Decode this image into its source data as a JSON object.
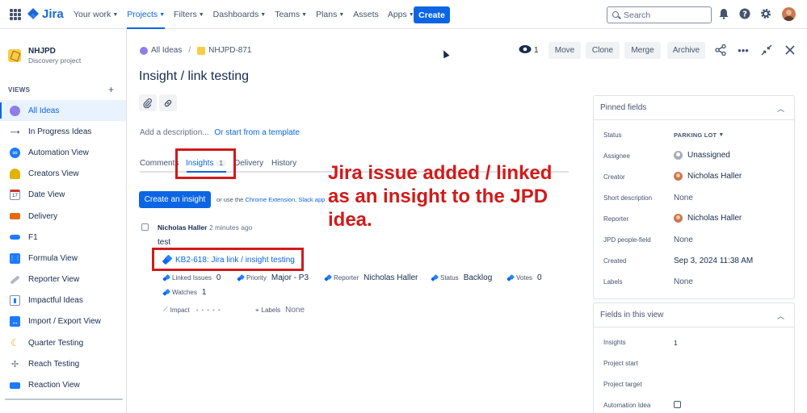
{
  "topnav": {
    "logo": "Jira",
    "items": [
      {
        "label": "Your work",
        "chevron": true,
        "active": false
      },
      {
        "label": "Projects",
        "chevron": true,
        "active": true
      },
      {
        "label": "Filters",
        "chevron": true,
        "active": false
      },
      {
        "label": "Dashboards",
        "chevron": true,
        "active": false
      },
      {
        "label": "Teams",
        "chevron": true,
        "active": false
      },
      {
        "label": "Plans",
        "chevron": true,
        "active": false
      },
      {
        "label": "Assets",
        "chevron": false,
        "active": false
      },
      {
        "label": "Apps",
        "chevron": true,
        "active": false
      }
    ],
    "create_label": "Create",
    "search_placeholder": "Search"
  },
  "sidebar": {
    "project_name": "NHJPD",
    "project_type": "Discovery project",
    "views_label": "VIEWS",
    "items": [
      {
        "label": "All Ideas",
        "icon": "globe-icon",
        "active": true,
        "color": "#8f7ee7"
      },
      {
        "label": "In Progress Ideas",
        "icon": "soon-arrow-icon",
        "active": false,
        "color": "#44546f"
      },
      {
        "label": "Automation View",
        "icon": "infinity-icon",
        "active": false,
        "color": "#1d7afc"
      },
      {
        "label": "Creators View",
        "icon": "construction-worker-icon",
        "active": false,
        "color": "#e2b203"
      },
      {
        "label": "Date View",
        "icon": "calendar-icon",
        "active": false,
        "color": "#c9372c"
      },
      {
        "label": "Delivery",
        "icon": "truck-icon",
        "active": false,
        "color": "#e56910"
      },
      {
        "label": "F1",
        "icon": "race-car-icon",
        "active": false,
        "color": "#1d7afc"
      },
      {
        "label": "Formula View",
        "icon": "abacus-icon",
        "active": false,
        "color": "#1d7afc"
      },
      {
        "label": "Reporter View",
        "icon": "syringe-icon",
        "active": false,
        "color": "#8590a2"
      },
      {
        "label": "Impactful Ideas",
        "icon": "bar-chart-icon",
        "active": false,
        "color": "#1d7afc"
      },
      {
        "label": "Import / Export View",
        "icon": "left-right-arrow-icon",
        "active": false,
        "color": "#1d7afc"
      },
      {
        "label": "Quarter Testing",
        "icon": "crescent-moon-icon",
        "active": false,
        "color": "#e2b203"
      },
      {
        "label": "Reach Testing",
        "icon": "satellite-icon",
        "active": false,
        "color": "#626f86"
      },
      {
        "label": "Reaction View",
        "icon": "cable-car-icon",
        "active": false,
        "color": "#1d7afc"
      }
    ]
  },
  "breadcrumb": {
    "root": "All Ideas",
    "key": "NHJPD-871"
  },
  "header": {
    "watch_count": "1",
    "buttons": [
      "Move",
      "Clone",
      "Merge",
      "Archive"
    ]
  },
  "idea": {
    "title": "Insight / link testing",
    "desc_placeholder": "Add a description...",
    "desc_template_link": "Or start from a template"
  },
  "tabs": {
    "comments": "Comments",
    "insights": "Insights",
    "insights_count": "1",
    "delivery": "Delivery",
    "history": "History"
  },
  "insights": {
    "create_button": "Create an insight",
    "ext_prefix": "or use the",
    "ext_link1": "Chrome Extension",
    "ext_sep": ",",
    "ext_link2": "Slack app",
    "author": "Nicholas Haller",
    "time": "2 minutes ago",
    "text": "test",
    "linked_issue": "KB2-618: Jira link / insight testing",
    "fields": {
      "linked_issues_label": "Linked Issues",
      "linked_issues_value": "0",
      "priority_label": "Priority",
      "priority_value": "Major - P3",
      "reporter_label": "Reporter",
      "reporter_value": "Nicholas Haller",
      "status_label": "Status",
      "status_value": "Backlog",
      "votes_label": "Votes",
      "votes_value": "0",
      "watches_label": "Watches",
      "watches_value": "1",
      "impact_label": "Impact",
      "labels_label": "Labels",
      "labels_value": "None"
    }
  },
  "annotation": "Jira issue added / linked as an insight to the JPD idea.",
  "pinned": {
    "title": "Pinned fields",
    "rows": [
      {
        "label": "Status",
        "value": "PARKING LOT"
      },
      {
        "label": "Assignee",
        "value": "Unassigned"
      },
      {
        "label": "Creator",
        "value": "Nicholas Haller"
      },
      {
        "label": "Short description",
        "value": "None"
      },
      {
        "label": "Reporter",
        "value": "Nicholas Haller"
      },
      {
        "label": "JPD people-field",
        "value": "None"
      },
      {
        "label": "Created",
        "value": "Sep 3, 2024 11:38 AM"
      },
      {
        "label": "Labels",
        "value": "None"
      }
    ]
  },
  "view_fields": {
    "title": "Fields in this view",
    "rows": [
      {
        "label": "Insights",
        "value": "1"
      },
      {
        "label": "Project start",
        "value": ""
      },
      {
        "label": "Project target",
        "value": ""
      },
      {
        "label": "Automation Idea",
        "value": ""
      }
    ]
  },
  "colors": {
    "accent": "#0c66e4",
    "annotation_red": "#d11a1a"
  }
}
